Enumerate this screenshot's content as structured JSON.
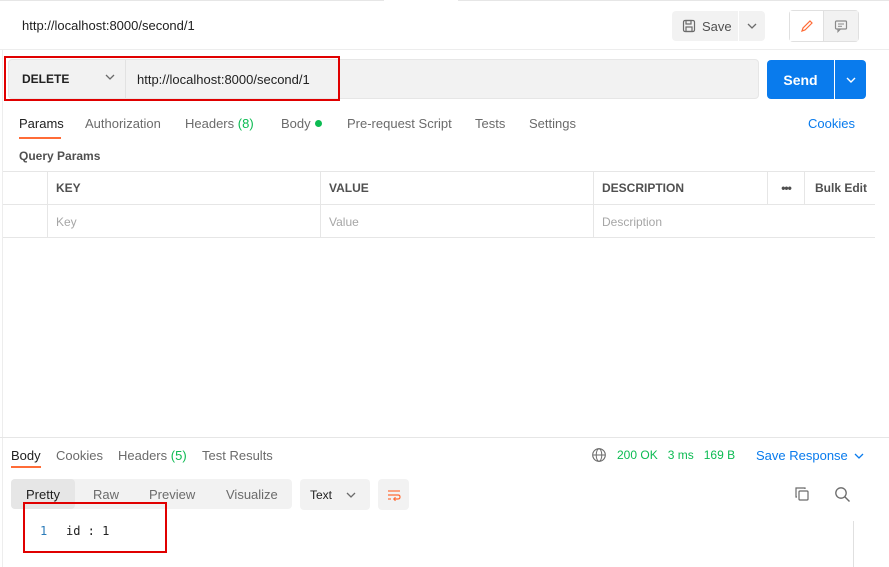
{
  "request": {
    "title": "http://localhost:8000/second/1",
    "save_label": "Save",
    "method": "DELETE",
    "url": "http://localhost:8000/second/1",
    "send_label": "Send"
  },
  "request_tabs": {
    "params": "Params",
    "authorization": "Authorization",
    "headers": "Headers",
    "headers_count": "(8)",
    "body": "Body",
    "pre_request": "Pre-request Script",
    "tests": "Tests",
    "settings": "Settings",
    "cookies": "Cookies"
  },
  "query_params": {
    "label": "Query Params",
    "columns": {
      "key": "KEY",
      "value": "VALUE",
      "description": "DESCRIPTION",
      "bulk_edit": "Bulk Edit",
      "more": "•••"
    },
    "placeholders": {
      "key": "Key",
      "value": "Value",
      "description": "Description"
    }
  },
  "response": {
    "tabs": {
      "body": "Body",
      "cookies": "Cookies",
      "headers": "Headers",
      "headers_count": "(5)",
      "test_results": "Test Results"
    },
    "status": "200 OK",
    "time": "3 ms",
    "size": "169 B",
    "save_response": "Save Response",
    "views": {
      "pretty": "Pretty",
      "raw": "Raw",
      "preview": "Preview",
      "visualize": "Visualize"
    },
    "format": "Text",
    "lines": [
      {
        "number": "1",
        "text": "id : 1"
      }
    ]
  },
  "colors": {
    "accent": "#097bed",
    "active_tab": "#ff6c37",
    "success": "#0cbb52",
    "highlight": "#e00000"
  },
  "icons": [
    "save-icon",
    "chevron-down-icon",
    "edit-pencil-icon",
    "comment-icon",
    "globe-icon",
    "wrap-lines-icon",
    "copy-icon",
    "search-icon"
  ]
}
